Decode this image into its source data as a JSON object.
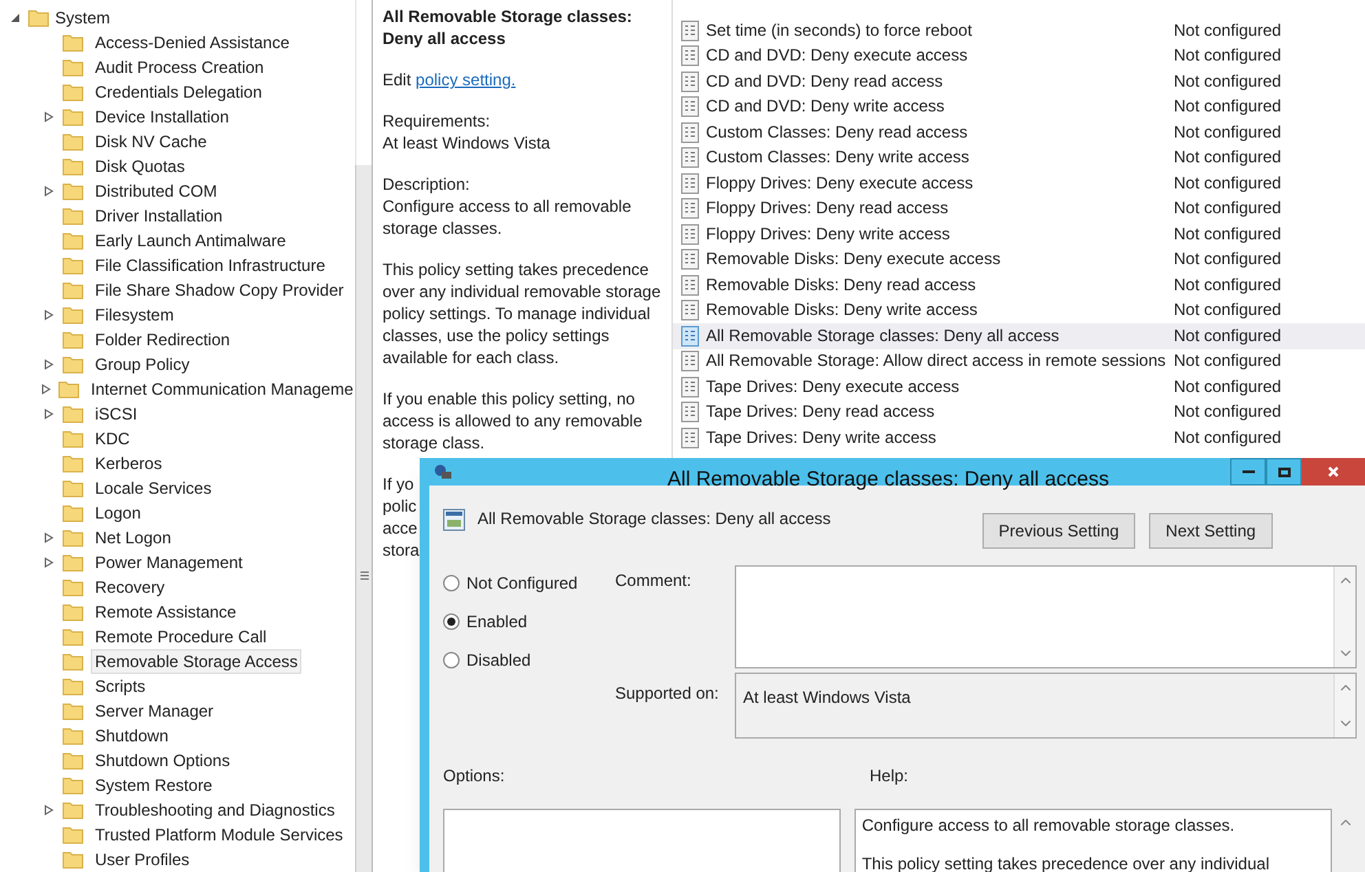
{
  "tree": {
    "label": "System",
    "expanded": true,
    "children": [
      {
        "label": "Access-Denied Assistance",
        "expandable": false,
        "selected": false
      },
      {
        "label": "Audit Process Creation",
        "expandable": false,
        "selected": false
      },
      {
        "label": "Credentials Delegation",
        "expandable": false,
        "selected": false
      },
      {
        "label": "Device Installation",
        "expandable": true,
        "selected": false
      },
      {
        "label": "Disk NV Cache",
        "expandable": false,
        "selected": false
      },
      {
        "label": "Disk Quotas",
        "expandable": false,
        "selected": false
      },
      {
        "label": "Distributed COM",
        "expandable": true,
        "selected": false
      },
      {
        "label": "Driver Installation",
        "expandable": false,
        "selected": false
      },
      {
        "label": "Early Launch Antimalware",
        "expandable": false,
        "selected": false
      },
      {
        "label": "File Classification Infrastructure",
        "expandable": false,
        "selected": false
      },
      {
        "label": "File Share Shadow Copy Provider",
        "expandable": false,
        "selected": false
      },
      {
        "label": "Filesystem",
        "expandable": true,
        "selected": false
      },
      {
        "label": "Folder Redirection",
        "expandable": false,
        "selected": false
      },
      {
        "label": "Group Policy",
        "expandable": true,
        "selected": false
      },
      {
        "label": "Internet Communication Manageme",
        "expandable": true,
        "selected": false
      },
      {
        "label": "iSCSI",
        "expandable": true,
        "selected": false
      },
      {
        "label": "KDC",
        "expandable": false,
        "selected": false
      },
      {
        "label": "Kerberos",
        "expandable": false,
        "selected": false
      },
      {
        "label": "Locale Services",
        "expandable": false,
        "selected": false
      },
      {
        "label": "Logon",
        "expandable": false,
        "selected": false
      },
      {
        "label": "Net Logon",
        "expandable": true,
        "selected": false
      },
      {
        "label": "Power Management",
        "expandable": true,
        "selected": false
      },
      {
        "label": "Recovery",
        "expandable": false,
        "selected": false
      },
      {
        "label": "Remote Assistance",
        "expandable": false,
        "selected": false
      },
      {
        "label": "Remote Procedure Call",
        "expandable": false,
        "selected": false
      },
      {
        "label": "Removable Storage Access",
        "expandable": false,
        "selected": true
      },
      {
        "label": "Scripts",
        "expandable": false,
        "selected": false
      },
      {
        "label": "Server Manager",
        "expandable": false,
        "selected": false
      },
      {
        "label": "Shutdown",
        "expandable": false,
        "selected": false
      },
      {
        "label": "Shutdown Options",
        "expandable": false,
        "selected": false
      },
      {
        "label": "System Restore",
        "expandable": false,
        "selected": false
      },
      {
        "label": "Troubleshooting and Diagnostics",
        "expandable": true,
        "selected": false
      },
      {
        "label": "Trusted Platform Module Services",
        "expandable": false,
        "selected": false
      },
      {
        "label": "User Profiles",
        "expandable": false,
        "selected": false
      }
    ]
  },
  "description": {
    "title": "All Removable Storage classes: Deny all access",
    "edit_prefix": "Edit",
    "edit_link": "policy setting.",
    "requirements_label": "Requirements:",
    "requirements": "At least Windows Vista",
    "description_label": "Description:",
    "paragraphs": [
      "Configure access to all removable storage classes.",
      "This policy setting takes precedence over any individual removable storage policy settings. To manage individual classes, use the policy settings available for each class.",
      "If you enable this policy setting, no access is allowed to any removable storage class."
    ],
    "cut_lines": [
      "If yo",
      "polic",
      "acce",
      "stora"
    ]
  },
  "settings": [
    {
      "name": "Set time (in seconds) to force reboot",
      "state": "Not configured",
      "selected": false
    },
    {
      "name": "CD and DVD: Deny execute access",
      "state": "Not configured",
      "selected": false
    },
    {
      "name": "CD and DVD: Deny read access",
      "state": "Not configured",
      "selected": false
    },
    {
      "name": "CD and DVD: Deny write access",
      "state": "Not configured",
      "selected": false
    },
    {
      "name": "Custom Classes: Deny read access",
      "state": "Not configured",
      "selected": false
    },
    {
      "name": "Custom Classes: Deny write access",
      "state": "Not configured",
      "selected": false
    },
    {
      "name": "Floppy Drives: Deny execute access",
      "state": "Not configured",
      "selected": false
    },
    {
      "name": "Floppy Drives: Deny read access",
      "state": "Not configured",
      "selected": false
    },
    {
      "name": "Floppy Drives: Deny write access",
      "state": "Not configured",
      "selected": false
    },
    {
      "name": "Removable Disks: Deny execute access",
      "state": "Not configured",
      "selected": false
    },
    {
      "name": "Removable Disks: Deny read access",
      "state": "Not configured",
      "selected": false
    },
    {
      "name": "Removable Disks: Deny write access",
      "state": "Not configured",
      "selected": false
    },
    {
      "name": "All Removable Storage classes: Deny all access",
      "state": "Not configured",
      "selected": true
    },
    {
      "name": "All Removable Storage: Allow direct access in remote sessions",
      "state": "Not configured",
      "selected": false
    },
    {
      "name": "Tape Drives: Deny execute access",
      "state": "Not configured",
      "selected": false
    },
    {
      "name": "Tape Drives: Deny read access",
      "state": "Not configured",
      "selected": false
    },
    {
      "name": "Tape Drives: Deny write access",
      "state": "Not configured",
      "selected": false
    }
  ],
  "dialog": {
    "title": "All Removable Storage classes: Deny all access",
    "heading": "All Removable Storage classes: Deny all access",
    "buttons": [
      "Previous Setting",
      "Next Setting"
    ],
    "options": [
      {
        "label": "Not Configured",
        "selected": false
      },
      {
        "label": "Enabled",
        "selected": true
      },
      {
        "label": "Disabled",
        "selected": false
      }
    ],
    "comment_label": "Comment:",
    "supported_label": "Supported on:",
    "supported_value": "At least Windows Vista",
    "options_label": "Options:",
    "help_label": "Help:",
    "help_lines": [
      "Configure access to all removable storage classes.",
      "This policy setting takes precedence over any individual"
    ]
  }
}
